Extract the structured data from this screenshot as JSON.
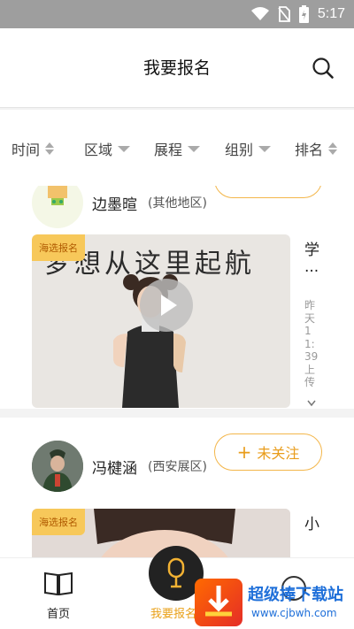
{
  "status_bar": {
    "time": "5:17"
  },
  "header": {
    "title": "我要报名"
  },
  "filters": [
    {
      "label": "时间",
      "indicator": "sort-icon"
    },
    {
      "label": "区域",
      "indicator": "chevron-down-icon"
    },
    {
      "label": "展程",
      "indicator": "chevron-down-icon"
    },
    {
      "label": "组别",
      "indicator": "chevron-down-icon"
    },
    {
      "label": "排名",
      "indicator": "sort-icon"
    }
  ],
  "feed": {
    "posts": [
      {
        "user_name": "边墨暄",
        "region": "(其他地区)",
        "badge": "海选报名",
        "video_caption": "梦想从这里起航",
        "side_title": "学",
        "side_ellipsis": "...",
        "side_meta": "昨天11:39上传"
      },
      {
        "user_name": "冯楗涵",
        "region": "(西安展区)",
        "follow_label": "未关注",
        "badge": "海选报名",
        "side_title": "小"
      }
    ]
  },
  "bottom_nav": {
    "home_label": "首页",
    "register_label": "我要报名"
  },
  "watermark": {
    "title": "超级捧下载站",
    "url": "www.cjbwh.com"
  },
  "colors": {
    "accent": "#e99c1a",
    "badge_bg": "#f7c85a",
    "status_bar": "#9e9e9e"
  }
}
